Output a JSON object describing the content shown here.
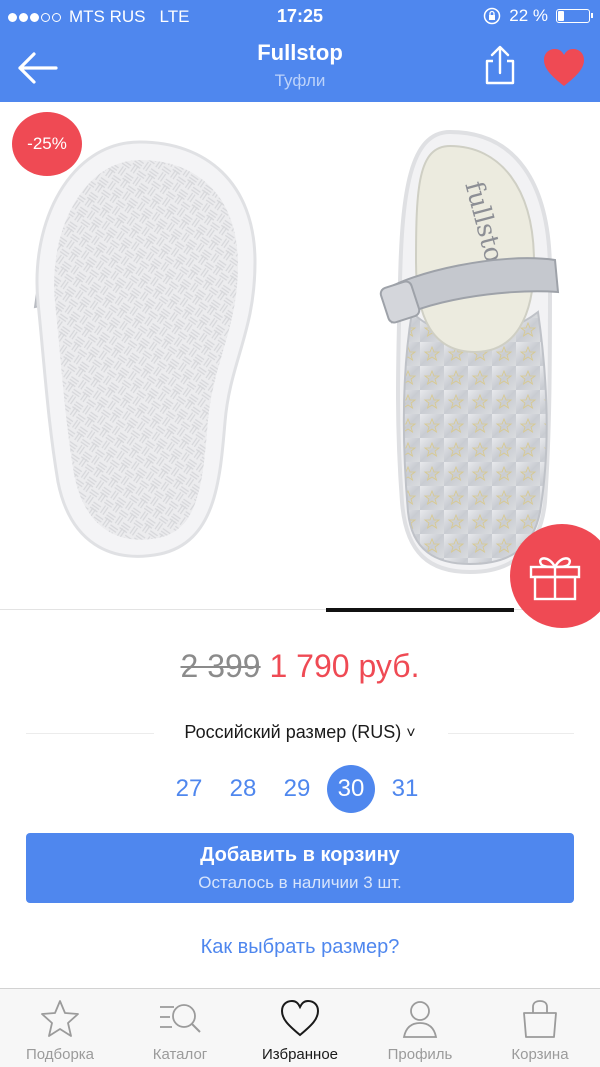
{
  "status_bar": {
    "carrier": "MTS RUS",
    "network": "LTE",
    "time": "17:25",
    "battery": "22 %",
    "battery_level": 0.22
  },
  "header": {
    "title": "Fullstop",
    "subtitle": "Туфли",
    "back_icon": "arrow-left-icon",
    "share_icon": "share-icon",
    "favorite_icon": "heart-icon"
  },
  "gallery": {
    "discount_badge": "-25%",
    "images": [
      "shoe-sole",
      "shoe-top"
    ],
    "active_page": 2,
    "page_count": 2,
    "gift_icon": "gift-icon"
  },
  "price": {
    "old": "2 399",
    "new": "1 790 руб."
  },
  "size": {
    "label": "Российский размер (RUS)",
    "chevron": "˅",
    "options": [
      "27",
      "28",
      "29",
      "30",
      "31"
    ],
    "selected": "30"
  },
  "cart": {
    "button_label": "Добавить в корзину",
    "stock_text": "Осталось в наличии 3 шт."
  },
  "size_guide_link": "Как выбрать размер?",
  "tabbar": {
    "items": [
      {
        "label": "Подборка",
        "icon": "star-icon"
      },
      {
        "label": "Каталог",
        "icon": "catalog-search-icon"
      },
      {
        "label": "Избранное",
        "icon": "heart-icon",
        "active": true
      },
      {
        "label": "Профиль",
        "icon": "person-icon"
      },
      {
        "label": "Корзина",
        "icon": "basket-icon"
      }
    ]
  },
  "colors": {
    "accent": "#4f87ee",
    "sale": "#ef4a54",
    "muted": "#9b9b9b"
  }
}
